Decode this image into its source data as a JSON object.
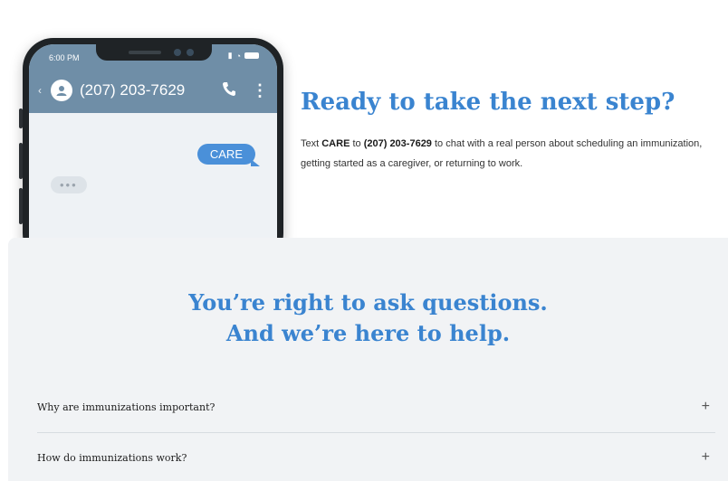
{
  "phone": {
    "status_time": "6:00 PM",
    "contact_number": "(207) 203-7629",
    "outgoing_message": "CARE",
    "typing_indicator": "•••",
    "icons": {
      "back": "chevron-left-icon",
      "avatar": "user-avatar-icon",
      "call": "phone-icon",
      "menu": "more-vertical-icon"
    }
  },
  "cta": {
    "title": "Ready to take the next step?",
    "text_prefix": "Text ",
    "keyword": "CARE",
    "text_to": " to ",
    "number": "(207) 203-7629",
    "text_suffix": " to chat with a real person about scheduling an immunization, getting started as a caregiver, or returning to work."
  },
  "faq": {
    "title_line1": "You’re right to ask questions.",
    "title_line2": "And we’re here to help.",
    "items": [
      {
        "question": "Why are immunizations important?",
        "toggle": "+"
      },
      {
        "question": "How do immunizations work?",
        "toggle": "+"
      }
    ]
  },
  "colors": {
    "accent_blue": "#3a84d0",
    "phone_header": "#6f8ea7",
    "bubble_blue": "#4a90d9",
    "faq_background": "#f1f3f5"
  }
}
